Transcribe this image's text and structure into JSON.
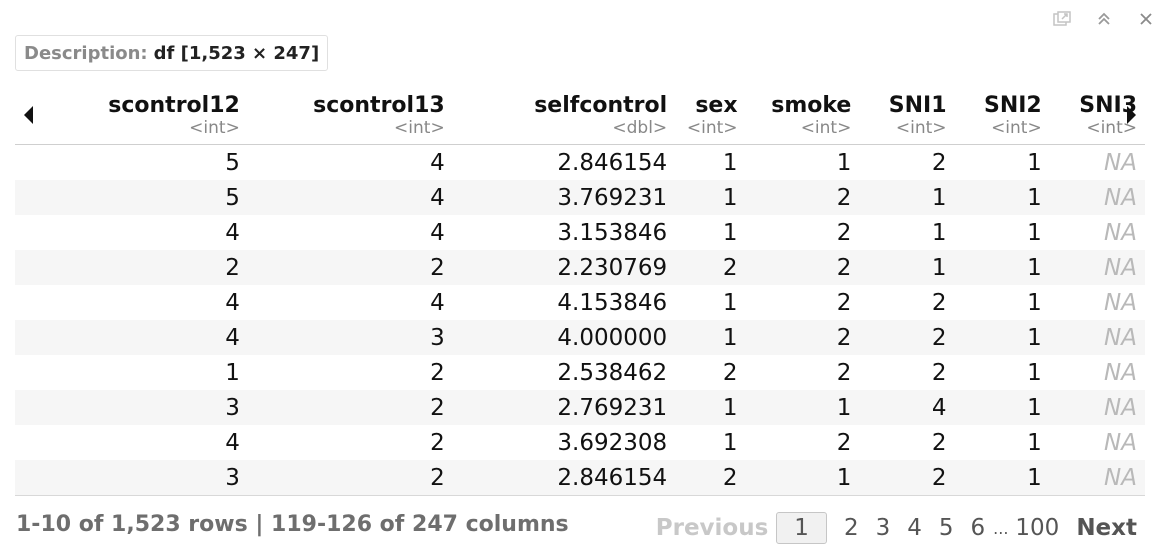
{
  "toolbar": {
    "icons": [
      "popout-icon",
      "collapse-icon",
      "close-icon"
    ]
  },
  "description": {
    "label": "Description:",
    "value": "df [1,523 × 247]"
  },
  "columns": [
    {
      "name": "scontrol12",
      "type": "<int>"
    },
    {
      "name": "scontrol13",
      "type": "<int>"
    },
    {
      "name": "selfcontrol",
      "type": "<dbl>"
    },
    {
      "name": "sex",
      "type": "<int>"
    },
    {
      "name": "smoke",
      "type": "<int>"
    },
    {
      "name": "SNI1",
      "type": "<int>"
    },
    {
      "name": "SNI2",
      "type": "<int>"
    },
    {
      "name": "SNI3",
      "type": "<int>"
    }
  ],
  "rows": [
    [
      "5",
      "4",
      "2.846154",
      "1",
      "1",
      "2",
      "1",
      "NA"
    ],
    [
      "5",
      "4",
      "3.769231",
      "1",
      "2",
      "1",
      "1",
      "NA"
    ],
    [
      "4",
      "4",
      "3.153846",
      "1",
      "2",
      "1",
      "1",
      "NA"
    ],
    [
      "2",
      "2",
      "2.230769",
      "2",
      "2",
      "1",
      "1",
      "NA"
    ],
    [
      "4",
      "4",
      "4.153846",
      "1",
      "2",
      "2",
      "1",
      "NA"
    ],
    [
      "4",
      "3",
      "4.000000",
      "1",
      "2",
      "2",
      "1",
      "NA"
    ],
    [
      "1",
      "2",
      "2.538462",
      "2",
      "2",
      "2",
      "1",
      "NA"
    ],
    [
      "3",
      "2",
      "2.769231",
      "1",
      "1",
      "4",
      "1",
      "NA"
    ],
    [
      "4",
      "2",
      "3.692308",
      "1",
      "2",
      "2",
      "1",
      "NA"
    ],
    [
      "3",
      "2",
      "2.846154",
      "2",
      "1",
      "2",
      "1",
      "NA"
    ]
  ],
  "footer": {
    "info": "1-10 of 1,523 rows | 119-126 of 247 columns",
    "previous": "Previous",
    "pages": [
      "1",
      "2",
      "3",
      "4",
      "5",
      "6"
    ],
    "ellipsis": "...",
    "last_page": "100",
    "next": "Next"
  },
  "colors": {
    "na_text": "#b9b9b9",
    "stripe": "#f6f6f6",
    "muted": "#888888"
  }
}
